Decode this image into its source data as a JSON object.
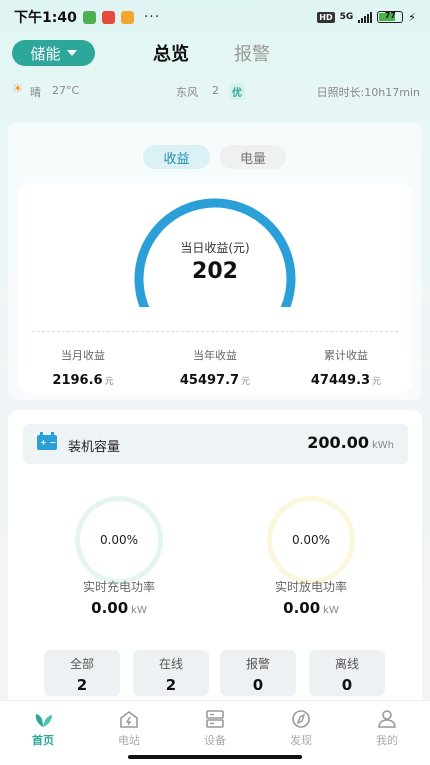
{
  "status_bar": {
    "time": "下午1:40",
    "dots": "···",
    "hd": "HD",
    "network": "5G",
    "battery": "77"
  },
  "header": {
    "mode": "储能",
    "tab_overview": "总览",
    "tab_alarm": "报警"
  },
  "weather": {
    "condition": "晴",
    "temperature": "27°C",
    "wind_dir": "东风",
    "wind_level": "2",
    "air_quality": "优",
    "sunshine": "日照时长:10h17min"
  },
  "segment": {
    "income": "收益",
    "energy": "电量"
  },
  "gauge": {
    "label": "当日收益(元)",
    "value": "202",
    "fill_fraction": 0.95
  },
  "stats": [
    {
      "label": "当月收益",
      "value": "2196.6",
      "unit": "元"
    },
    {
      "label": "当年收益",
      "value": "45497.7",
      "unit": "元"
    },
    {
      "label": "累计收益",
      "value": "47449.3",
      "unit": "元"
    }
  ],
  "capacity": {
    "label": "装机容量",
    "value": "200.00",
    "unit": "kWh"
  },
  "power": {
    "charge": {
      "percent": "0.00%",
      "label": "实时充电功率",
      "value": "0.00",
      "unit": "kW"
    },
    "discharge": {
      "percent": "0.00%",
      "label": "实时放电功率",
      "value": "0.00",
      "unit": "kW"
    }
  },
  "counts": [
    {
      "label": "全部",
      "value": "2"
    },
    {
      "label": "在线",
      "value": "2"
    },
    {
      "label": "报警",
      "value": "0"
    },
    {
      "label": "离线",
      "value": "0"
    }
  ],
  "nav": [
    {
      "label": "首页",
      "icon": "leaf-icon",
      "active": true
    },
    {
      "label": "电站",
      "icon": "power-station-icon"
    },
    {
      "label": "设备",
      "icon": "device-icon"
    },
    {
      "label": "发现",
      "icon": "compass-icon"
    },
    {
      "label": "我的",
      "icon": "user-icon"
    }
  ],
  "colors": {
    "accent": "#2ea79b",
    "gauge": "#2a9fd8"
  }
}
